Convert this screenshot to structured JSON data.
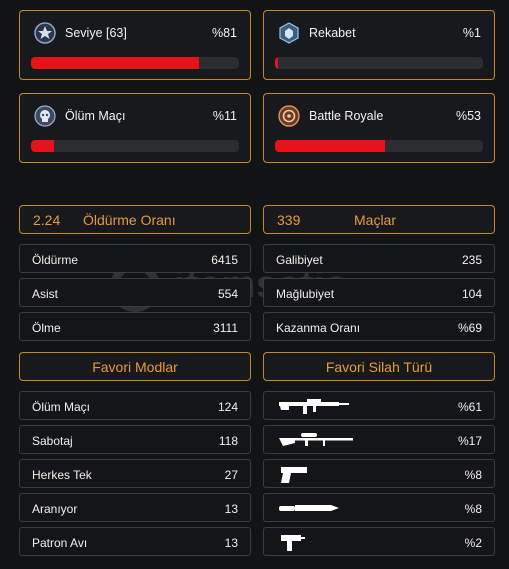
{
  "modes": [
    {
      "title": "Seviye [63]",
      "percent_label": "%81",
      "fill": 0.81,
      "icon": "rank-badge-icon"
    },
    {
      "title": "Rekabet",
      "percent_label": "%1",
      "fill": 0.01,
      "icon": "ranked-emblem-icon"
    },
    {
      "title": "Ölüm Maçı",
      "percent_label": "%11",
      "fill": 0.11,
      "icon": "deathmatch-emblem-icon"
    },
    {
      "title": "Battle Royale",
      "percent_label": "%53",
      "fill": 0.53,
      "icon": "battle-royale-emblem-icon"
    }
  ],
  "kd": {
    "value": "2.24",
    "label": "Öldürme Oranı"
  },
  "matches": {
    "value": "339",
    "label": "Maçlar"
  },
  "kill_stats": [
    {
      "label": "Öldürme",
      "value": "6415"
    },
    {
      "label": "Asist",
      "value": "554"
    },
    {
      "label": "Ölme",
      "value": "3111"
    }
  ],
  "match_stats": [
    {
      "label": "Galibiyet",
      "value": "235"
    },
    {
      "label": "Mağlubiyet",
      "value": "104"
    },
    {
      "label": "Kazanma Oranı",
      "value": "%69"
    }
  ],
  "favorite_modes": {
    "title": "Favori Modlar",
    "items": [
      {
        "label": "Ölüm Maçı",
        "value": "124"
      },
      {
        "label": "Sabotaj",
        "value": "118"
      },
      {
        "label": "Herkes Tek",
        "value": "27"
      },
      {
        "label": "Aranıyor",
        "value": "13"
      },
      {
        "label": "Patron Avı",
        "value": "13"
      }
    ]
  },
  "favorite_weapons": {
    "title": "Favori Silah Türü",
    "items": [
      {
        "icon": "assault-rifle-icon",
        "value": "%61"
      },
      {
        "icon": "sniper-rifle-icon",
        "value": "%17"
      },
      {
        "icon": "pistol-icon",
        "value": "%8"
      },
      {
        "icon": "knife-icon",
        "value": "%8"
      },
      {
        "icon": "smg-icon",
        "value": "%2"
      }
    ]
  },
  "watermark": "itemsatis",
  "colors": {
    "accent": "#c8881f",
    "header_text": "#e79a3a",
    "bar_fill": "#e6131a",
    "bar_track": "#2b2d31",
    "background": "#121315"
  }
}
